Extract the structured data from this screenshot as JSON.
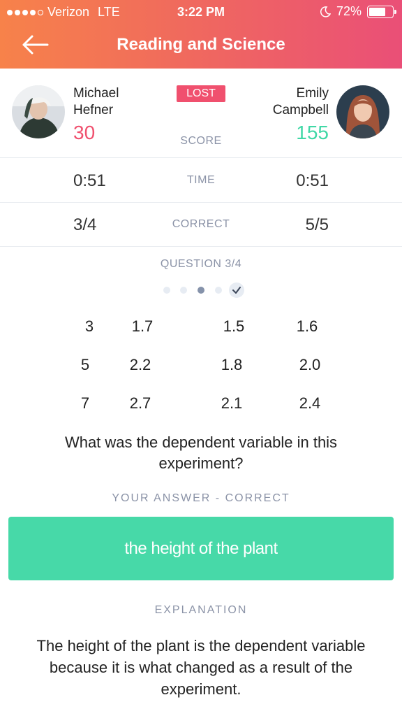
{
  "status": {
    "carrier": "Verizon",
    "network": "LTE",
    "time": "3:22 PM",
    "battery": "72%",
    "battery_level": 0.72
  },
  "header": {
    "title": "Reading and Science"
  },
  "players": {
    "left": {
      "first": "Michael",
      "last": "Hefner",
      "score": "30"
    },
    "right": {
      "first": "Emily",
      "last": "Campbell",
      "score": "155"
    },
    "result": "LOST",
    "score_label": "SCORE"
  },
  "stats": {
    "time": {
      "label": "TIME",
      "left": "0:51",
      "right": "0:51"
    },
    "correct": {
      "label": "CORRECT",
      "left": "3/4",
      "right": "5/5"
    }
  },
  "question": {
    "label": "QUESTION 3/4",
    "text": "What was the dependent variable in this experiment?",
    "table": [
      [
        "3",
        "1.7",
        "1.5",
        "1.6"
      ],
      [
        "5",
        "2.2",
        "1.8",
        "2.0"
      ],
      [
        "7",
        "2.7",
        "2.1",
        "2.4"
      ]
    ]
  },
  "answer": {
    "label": "YOUR ANSWER - CORRECT",
    "text": "the height of the plant"
  },
  "explanation": {
    "label": "EXPLANATION",
    "text": "The height of the plant is the dependent variable because it is what changed as a result of the experiment."
  },
  "colors": {
    "header_start": "#f7824a",
    "header_end": "#ea4f77",
    "lost": "#f0506e",
    "winner": "#40d8a6",
    "answer_bg": "#47d9a8"
  }
}
